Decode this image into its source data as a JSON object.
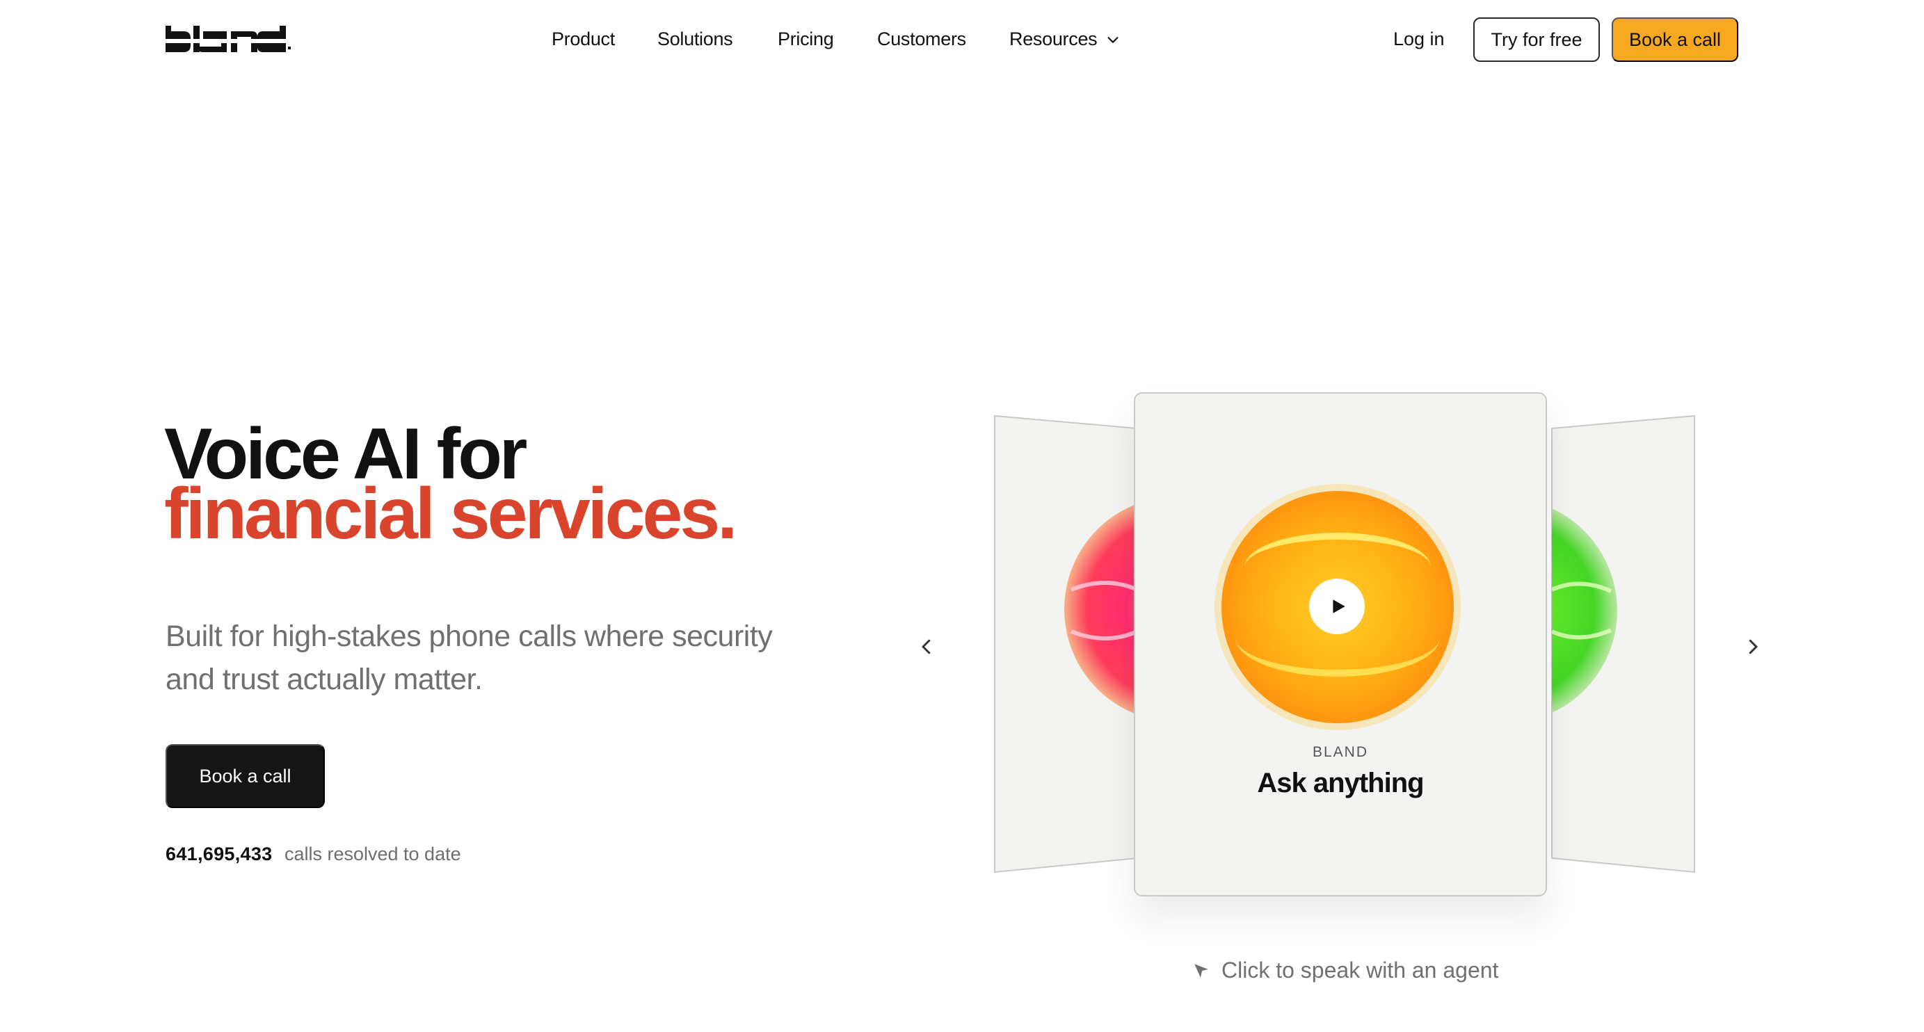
{
  "brand": {
    "logo_text": "bland"
  },
  "nav": {
    "links": [
      "Product",
      "Solutions",
      "Pricing",
      "Customers"
    ],
    "resources_label": "Resources",
    "login_label": "Log in",
    "try_label": "Try for free",
    "book_label": "Book a call",
    "accent_color": "#f6a920"
  },
  "hero": {
    "title_line1": "Voice AI for",
    "title_line2": "financial services.",
    "title_accent_color": "#d8442c",
    "subtitle": "Built for high-stakes phone calls where security and trust actually matter.",
    "cta_label": "Book a call",
    "stat_number": "641,695,433",
    "stat_label": "calls resolved to date"
  },
  "carousel": {
    "card_label": "BLAND",
    "card_title": "Ask anything",
    "hint": "Click to speak with an agent",
    "orb_colors": {
      "left": "#ff2e6e",
      "center": "#ffa414",
      "right": "#5ee82a"
    }
  }
}
